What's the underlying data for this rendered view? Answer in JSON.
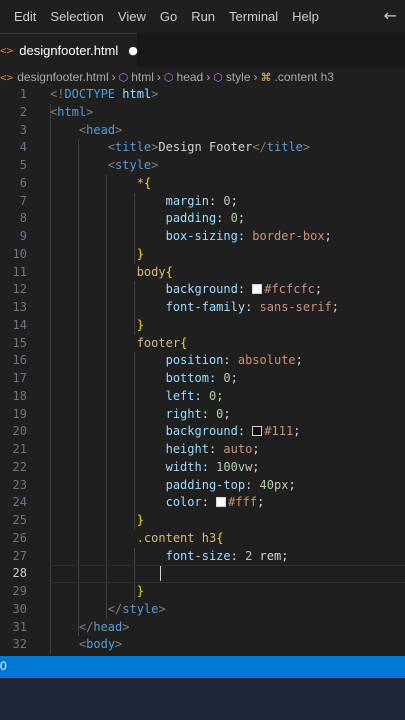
{
  "menu": [
    "Edit",
    "Selection",
    "View",
    "Go",
    "Run",
    "Terminal",
    "Help"
  ],
  "tab": {
    "icon": "<>",
    "label": "designfooter.html",
    "modified_dot": "●"
  },
  "breadcrumb": {
    "file": "designfooter.html",
    "items": [
      "html",
      "head",
      "style",
      ".content h3"
    ]
  },
  "status": {
    "left": "0"
  },
  "code_lines": [
    {
      "n": "1",
      "tokens": [
        [
          "p",
          "<!"
        ],
        [
          "t",
          "DOCTYPE"
        ],
        [
          "x",
          " "
        ],
        [
          "prop",
          "html"
        ],
        [
          "p",
          ">"
        ]
      ]
    },
    {
      "n": "2",
      "tokens": [
        [
          "p",
          "<"
        ],
        [
          "t",
          "html"
        ],
        [
          "p",
          ">"
        ]
      ]
    },
    {
      "n": "3",
      "tokens": [
        [
          "x",
          "    "
        ],
        [
          "p",
          "<"
        ],
        [
          "t",
          "head"
        ],
        [
          "p",
          ">"
        ]
      ]
    },
    {
      "n": "4",
      "tokens": [
        [
          "x",
          "        "
        ],
        [
          "p",
          "<"
        ],
        [
          "t",
          "title"
        ],
        [
          "p",
          ">"
        ],
        [
          "x",
          "Design Footer"
        ],
        [
          "p",
          "</"
        ],
        [
          "t",
          "title"
        ],
        [
          "p",
          ">"
        ]
      ]
    },
    {
      "n": "5",
      "tokens": [
        [
          "x",
          "        "
        ],
        [
          "p",
          "<"
        ],
        [
          "t",
          "style"
        ],
        [
          "p",
          ">"
        ]
      ]
    },
    {
      "n": "6",
      "tokens": [
        [
          "x",
          "            "
        ],
        [
          "sel",
          "*"
        ],
        [
          "b",
          "{"
        ]
      ]
    },
    {
      "n": "7",
      "tokens": [
        [
          "x",
          "                "
        ],
        [
          "prop",
          "margin"
        ],
        [
          "x",
          ": "
        ],
        [
          "num",
          "0"
        ],
        [
          "x",
          ";"
        ]
      ]
    },
    {
      "n": "8",
      "tokens": [
        [
          "x",
          "                "
        ],
        [
          "prop",
          "padding"
        ],
        [
          "x",
          ": "
        ],
        [
          "num",
          "0"
        ],
        [
          "x",
          ";"
        ]
      ]
    },
    {
      "n": "9",
      "tokens": [
        [
          "x",
          "                "
        ],
        [
          "prop",
          "box-sizing"
        ],
        [
          "x",
          ": "
        ],
        [
          "str",
          "border-box"
        ],
        [
          "x",
          ";"
        ]
      ]
    },
    {
      "n": "10",
      "tokens": [
        [
          "x",
          "            "
        ],
        [
          "b",
          "}"
        ]
      ]
    },
    {
      "n": "11",
      "tokens": [
        [
          "x",
          "            "
        ],
        [
          "sel",
          "body"
        ],
        [
          "b",
          "{"
        ]
      ]
    },
    {
      "n": "12",
      "tokens": [
        [
          "x",
          "                "
        ],
        [
          "prop",
          "background"
        ],
        [
          "x",
          ": "
        ],
        [
          "sw",
          "#fcfcfc"
        ],
        [
          "str",
          "#fcfcfc"
        ],
        [
          "x",
          ";"
        ]
      ]
    },
    {
      "n": "13",
      "tokens": [
        [
          "x",
          "                "
        ],
        [
          "prop",
          "font-family"
        ],
        [
          "x",
          ": "
        ],
        [
          "str",
          "sans-serif"
        ],
        [
          "x",
          ";"
        ]
      ]
    },
    {
      "n": "14",
      "tokens": [
        [
          "x",
          "            "
        ],
        [
          "b",
          "}"
        ]
      ]
    },
    {
      "n": "15",
      "tokens": [
        [
          "x",
          "            "
        ],
        [
          "sel",
          "footer"
        ],
        [
          "b",
          "{"
        ]
      ]
    },
    {
      "n": "16",
      "tokens": [
        [
          "x",
          "                "
        ],
        [
          "prop",
          "position"
        ],
        [
          "x",
          ": "
        ],
        [
          "str",
          "absolute"
        ],
        [
          "x",
          ";"
        ]
      ]
    },
    {
      "n": "17",
      "tokens": [
        [
          "x",
          "                "
        ],
        [
          "prop",
          "bottom"
        ],
        [
          "x",
          ": "
        ],
        [
          "num",
          "0"
        ],
        [
          "x",
          ";"
        ]
      ]
    },
    {
      "n": "18",
      "tokens": [
        [
          "x",
          "                "
        ],
        [
          "prop",
          "left"
        ],
        [
          "x",
          ": "
        ],
        [
          "num",
          "0"
        ],
        [
          "x",
          ";"
        ]
      ]
    },
    {
      "n": "19",
      "tokens": [
        [
          "x",
          "                "
        ],
        [
          "prop",
          "right"
        ],
        [
          "x",
          ": "
        ],
        [
          "num",
          "0"
        ],
        [
          "x",
          ";"
        ]
      ]
    },
    {
      "n": "20",
      "tokens": [
        [
          "x",
          "                "
        ],
        [
          "prop",
          "background"
        ],
        [
          "x",
          ": "
        ],
        [
          "sw",
          "#111"
        ],
        [
          "str",
          "#111"
        ],
        [
          "x",
          ";"
        ]
      ]
    },
    {
      "n": "21",
      "tokens": [
        [
          "x",
          "                "
        ],
        [
          "prop",
          "height"
        ],
        [
          "x",
          ": "
        ],
        [
          "str",
          "auto"
        ],
        [
          "x",
          ";"
        ]
      ]
    },
    {
      "n": "22",
      "tokens": [
        [
          "x",
          "                "
        ],
        [
          "prop",
          "width"
        ],
        [
          "x",
          ": "
        ],
        [
          "num",
          "100vw"
        ],
        [
          "x",
          ";"
        ]
      ]
    },
    {
      "n": "23",
      "tokens": [
        [
          "x",
          "                "
        ],
        [
          "prop",
          "padding-top"
        ],
        [
          "x",
          ": "
        ],
        [
          "num",
          "40px"
        ],
        [
          "x",
          ";"
        ]
      ]
    },
    {
      "n": "24",
      "tokens": [
        [
          "x",
          "                "
        ],
        [
          "prop",
          "color"
        ],
        [
          "x",
          ": "
        ],
        [
          "sw",
          "#fff"
        ],
        [
          "str",
          "#fff"
        ],
        [
          "x",
          ";"
        ]
      ]
    },
    {
      "n": "25",
      "tokens": [
        [
          "x",
          "            "
        ],
        [
          "b",
          "}"
        ]
      ]
    },
    {
      "n": "26",
      "tokens": [
        [
          "x",
          "            "
        ],
        [
          "sel",
          ".content h3"
        ],
        [
          "b",
          "{"
        ]
      ]
    },
    {
      "n": "27",
      "tokens": [
        [
          "x",
          "                "
        ],
        [
          "prop",
          "font-size"
        ],
        [
          "x",
          ": "
        ],
        [
          "num",
          "2"
        ],
        [
          "x",
          " rem;"
        ]
      ]
    },
    {
      "n": "28",
      "tokens": [
        [
          "x",
          ""
        ]
      ]
    },
    {
      "n": "29",
      "tokens": [
        [
          "x",
          "            "
        ],
        [
          "b",
          "}"
        ]
      ]
    },
    {
      "n": "30",
      "tokens": [
        [
          "x",
          "        "
        ],
        [
          "p",
          "</"
        ],
        [
          "t",
          "style"
        ],
        [
          "p",
          ">"
        ]
      ]
    },
    {
      "n": "31",
      "tokens": [
        [
          "x",
          "    "
        ],
        [
          "p",
          "</"
        ],
        [
          "t",
          "head"
        ],
        [
          "p",
          ">"
        ]
      ]
    },
    {
      "n": "32",
      "tokens": [
        [
          "x",
          "    "
        ],
        [
          "p",
          "<"
        ],
        [
          "t",
          "body"
        ],
        [
          "p",
          ">"
        ]
      ]
    }
  ],
  "colors": {
    "status_bar": "#0078d4",
    "editor_bg": "#1f1f1f",
    "accent_orange": "#e37933"
  },
  "icons": [
    "html-file-icon",
    "back-arrow-icon",
    "chevron-right-icon",
    "cube-icon",
    "css-selector-icon"
  ]
}
